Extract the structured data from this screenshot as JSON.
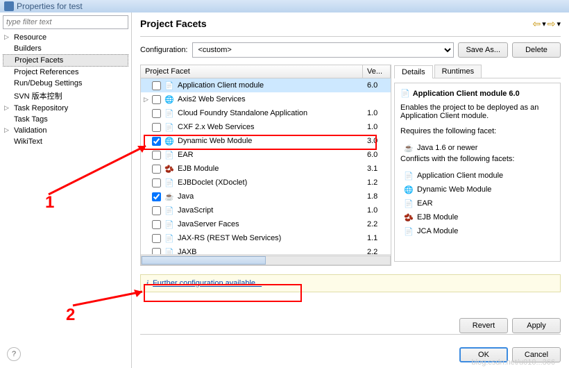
{
  "titlebar": {
    "title": "Properties for test"
  },
  "sidebar": {
    "filter_placeholder": "type filter text",
    "items": [
      {
        "label": "Resource",
        "expandable": true
      },
      {
        "label": "Builders",
        "expandable": false
      },
      {
        "label": "Project Facets",
        "expandable": false,
        "selected": true
      },
      {
        "label": "Project References",
        "expandable": false
      },
      {
        "label": "Run/Debug Settings",
        "expandable": false
      },
      {
        "label": "SVN 版本控制",
        "expandable": false
      },
      {
        "label": "Task Repository",
        "expandable": true
      },
      {
        "label": "Task Tags",
        "expandable": false
      },
      {
        "label": "Validation",
        "expandable": true
      },
      {
        "label": "WikiText",
        "expandable": false
      }
    ]
  },
  "main": {
    "heading": "Project Facets",
    "config_label": "Configuration:",
    "config_value": "<custom>",
    "save_as": "Save As...",
    "delete": "Delete",
    "facet_col_name": "Project Facet",
    "facet_col_ver": "Ve...",
    "facets": [
      {
        "name": "Application Client module",
        "ver": "6.0",
        "checked": false,
        "highlight": true,
        "icon": "doc"
      },
      {
        "name": "Axis2 Web Services",
        "ver": "",
        "checked": false,
        "expandable": true,
        "icon": "globe"
      },
      {
        "name": "Cloud Foundry Standalone Application",
        "ver": "1.0",
        "checked": false,
        "icon": "doc"
      },
      {
        "name": "CXF 2.x Web Services",
        "ver": "1.0",
        "checked": false,
        "icon": "doc"
      },
      {
        "name": "Dynamic Web Module",
        "ver": "3.0",
        "checked": true,
        "icon": "globe"
      },
      {
        "name": "EAR",
        "ver": "6.0",
        "checked": false,
        "icon": "doc"
      },
      {
        "name": "EJB Module",
        "ver": "3.1",
        "checked": false,
        "icon": "bean"
      },
      {
        "name": "EJBDoclet (XDoclet)",
        "ver": "1.2",
        "checked": false,
        "icon": "doc"
      },
      {
        "name": "Java",
        "ver": "1.8",
        "checked": true,
        "icon": "java"
      },
      {
        "name": "JavaScript",
        "ver": "1.0",
        "checked": false,
        "icon": "doc"
      },
      {
        "name": "JavaServer Faces",
        "ver": "2.2",
        "checked": false,
        "icon": "doc"
      },
      {
        "name": "JAX-RS (REST Web Services)",
        "ver": "1.1",
        "checked": false,
        "icon": "doc"
      },
      {
        "name": "JAXB",
        "ver": "2.2",
        "checked": false,
        "icon": "doc"
      }
    ],
    "tabs": {
      "details": "Details",
      "runtimes": "Runtimes"
    },
    "details": {
      "title": "Application Client module 6.0",
      "desc": "Enables the project to be deployed as an Application Client module.",
      "requires_label": "Requires the following facet:",
      "requires": [
        {
          "name": "Java 1.6 or newer",
          "icon": "java"
        }
      ],
      "conflicts_label": "Conflicts with the following facets:",
      "conflicts": [
        {
          "name": "Application Client module",
          "icon": "doc"
        },
        {
          "name": "Dynamic Web Module",
          "icon": "globe"
        },
        {
          "name": "EAR",
          "icon": "doc"
        },
        {
          "name": "EJB Module",
          "icon": "bean"
        },
        {
          "name": "JCA Module",
          "icon": "doc"
        }
      ]
    },
    "info_link": "Further configuration available...",
    "revert": "Revert",
    "apply": "Apply",
    "ok": "OK",
    "cancel": "Cancel"
  },
  "annotations": {
    "label1": "1",
    "label2": "2"
  },
  "watermark": "blog.csdn.net/u010...366"
}
